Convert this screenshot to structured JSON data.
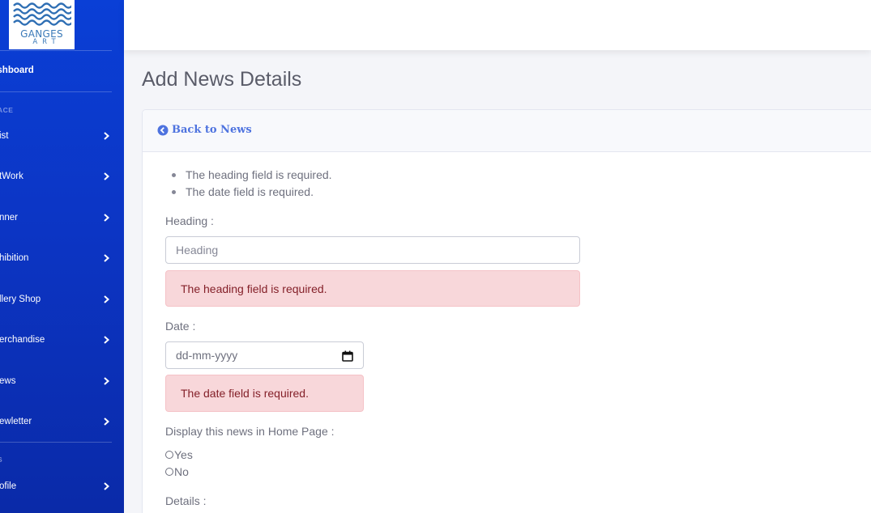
{
  "brand": {
    "line1": "GANGES",
    "line2": "ART"
  },
  "sidebar": {
    "dashboard_label": "ashboard",
    "section1_heading": "ACE",
    "items": [
      {
        "label": "ist"
      },
      {
        "label": "tWork"
      },
      {
        "label": "nner"
      },
      {
        "label": "hibition"
      },
      {
        "label": "llery Shop"
      },
      {
        "label": "erchandise"
      },
      {
        "label": "ews"
      },
      {
        "label": "ewletter"
      }
    ],
    "section2_heading": "S",
    "profile_label": "ofile"
  },
  "page": {
    "title": "Add News Details"
  },
  "card": {
    "back_label": "Back to News",
    "errors": [
      "The heading field is required.",
      "The date field is required."
    ],
    "heading_label": "Heading :",
    "heading_placeholder": "Heading",
    "heading_value": "",
    "heading_error": "The heading field is required.",
    "date_label": "Date :",
    "date_placeholder": "dd-mm-yyyy",
    "date_error": "The date field is required.",
    "display_label": "Display this news in Home Page :",
    "radio_yes": "Yes",
    "radio_no": "No",
    "details_label": "Details :"
  },
  "colors": {
    "sidebar": "#0a3fd6",
    "link": "#4e73df",
    "alert_bg": "#f8d7da",
    "alert_text": "#842029"
  }
}
